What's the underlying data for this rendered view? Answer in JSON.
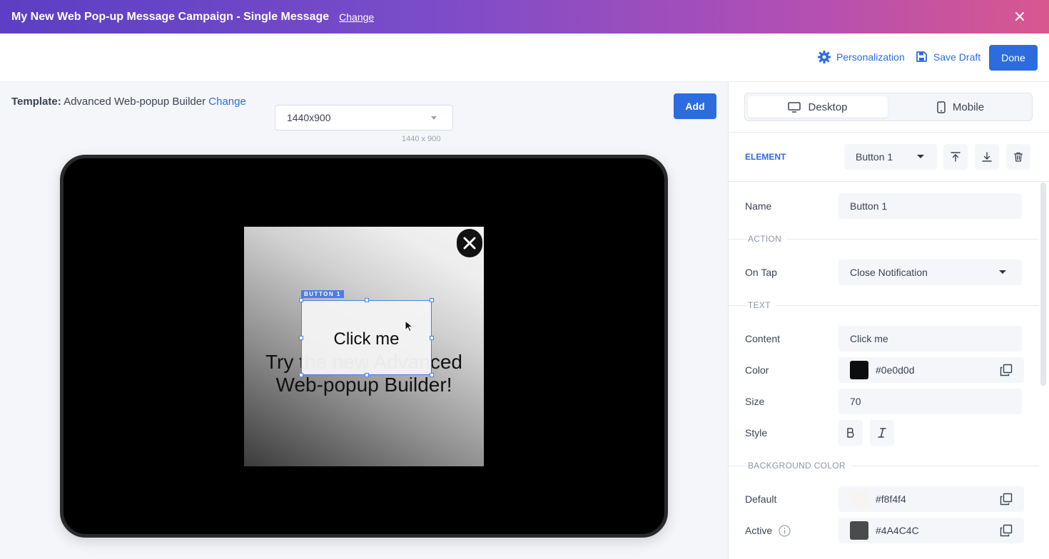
{
  "banner": {
    "title": "My New Web Pop-up Message Campaign - Single Message",
    "change_label": "Change"
  },
  "toolbar": {
    "personalization_label": "Personalization",
    "save_draft_label": "Save Draft",
    "done_label": "Done"
  },
  "template": {
    "label": "Template:",
    "name": "Advanced Web-popup Builder",
    "change_label": "Change"
  },
  "canvas": {
    "size_select_value": "1440x900",
    "size_hint": "1440 x 900",
    "add_label": "Add",
    "popup_text": "Try the new Advanced Web-popup Builder!",
    "button_text": "Click me",
    "button_tag": "BUTTON 1"
  },
  "panel": {
    "tabs": [
      {
        "label": "Desktop",
        "icon": "desktop-icon"
      },
      {
        "label": "Mobile",
        "icon": "mobile-icon"
      }
    ],
    "element_label": "ELEMENT",
    "element_value": "Button 1",
    "name_label": "Name",
    "name_value": "Button 1",
    "action_section": "ACTION",
    "on_tap_label": "On Tap",
    "on_tap_value": "Close Notification",
    "text_section": "TEXT",
    "content_label": "Content",
    "content_value": "Click me",
    "color_label": "Color",
    "color_value": "#0e0d0d",
    "size_label": "Size",
    "size_value": "70",
    "style_label": "Style",
    "bg_section": "BACKGROUND COLOR",
    "default_label": "Default",
    "default_value": "#f8f4f4",
    "active_label": "Active",
    "active_value": "#4A4C4C"
  },
  "colors": {
    "accent": "#2d6cdf",
    "text_color": "#0e0d0d",
    "bg_default": "#f8f4f4",
    "bg_active": "#4A4C4C"
  }
}
